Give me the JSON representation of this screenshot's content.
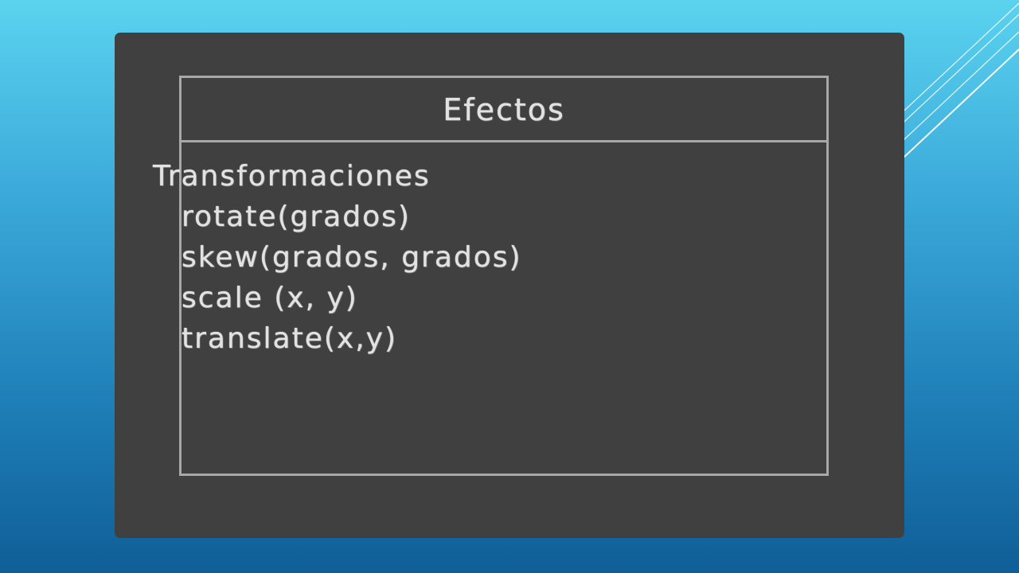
{
  "slide": {
    "title": "Efectos",
    "heading": "Transformaciones",
    "items": [
      "rotate(grados)",
      "skew(grados, grados)",
      "scale (x, y)",
      "translate(x,y)"
    ]
  },
  "colors": {
    "board": "#404040",
    "chalk": "#e2e2e2",
    "frame": "#a8a8a8",
    "accent_lines": "#ffffff"
  }
}
